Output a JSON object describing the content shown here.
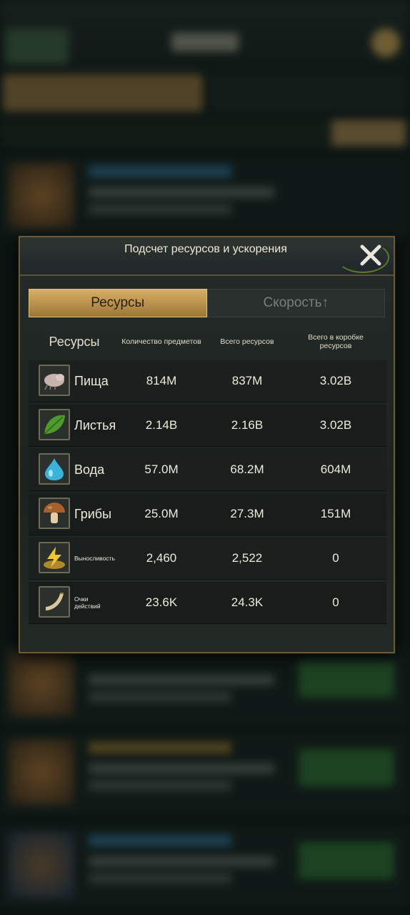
{
  "dialog": {
    "title": "Подсчет ресурсов и ускорения",
    "tabs": [
      {
        "label": "Ресурсы",
        "active": true
      },
      {
        "label": "Скорость↑",
        "active": false
      }
    ],
    "headers": {
      "resource": "Ресурсы",
      "items_count": "Количество предметов",
      "total": "Всего ресурсов",
      "box_total": "Всего в коробке ресурсов"
    },
    "rows": [
      {
        "icon": "larva-icon",
        "name": "Пища",
        "items": "814M",
        "total": "837M",
        "box": "3.02B"
      },
      {
        "icon": "leaf-icon",
        "name": "Листья",
        "items": "2.14B",
        "total": "2.16B",
        "box": "3.02B"
      },
      {
        "icon": "water-drop-icon",
        "name": "Вода",
        "items": "57.0M",
        "total": "68.2M",
        "box": "604M"
      },
      {
        "icon": "mushroom-icon",
        "name": "Грибы",
        "items": "25.0M",
        "total": "27.3M",
        "box": "151M"
      },
      {
        "icon": "lightning-gold-icon",
        "name": "Выносливость",
        "items": "2,460",
        "total": "2,522",
        "box": "0"
      },
      {
        "icon": "horn-icon",
        "name": "Очки действий",
        "items": "23.6K",
        "total": "24.3K",
        "box": "0"
      }
    ]
  },
  "colors": {
    "accent_gold": "#c9a15a",
    "dialog_bg": "#1f2523",
    "border": "#6b5a38"
  }
}
